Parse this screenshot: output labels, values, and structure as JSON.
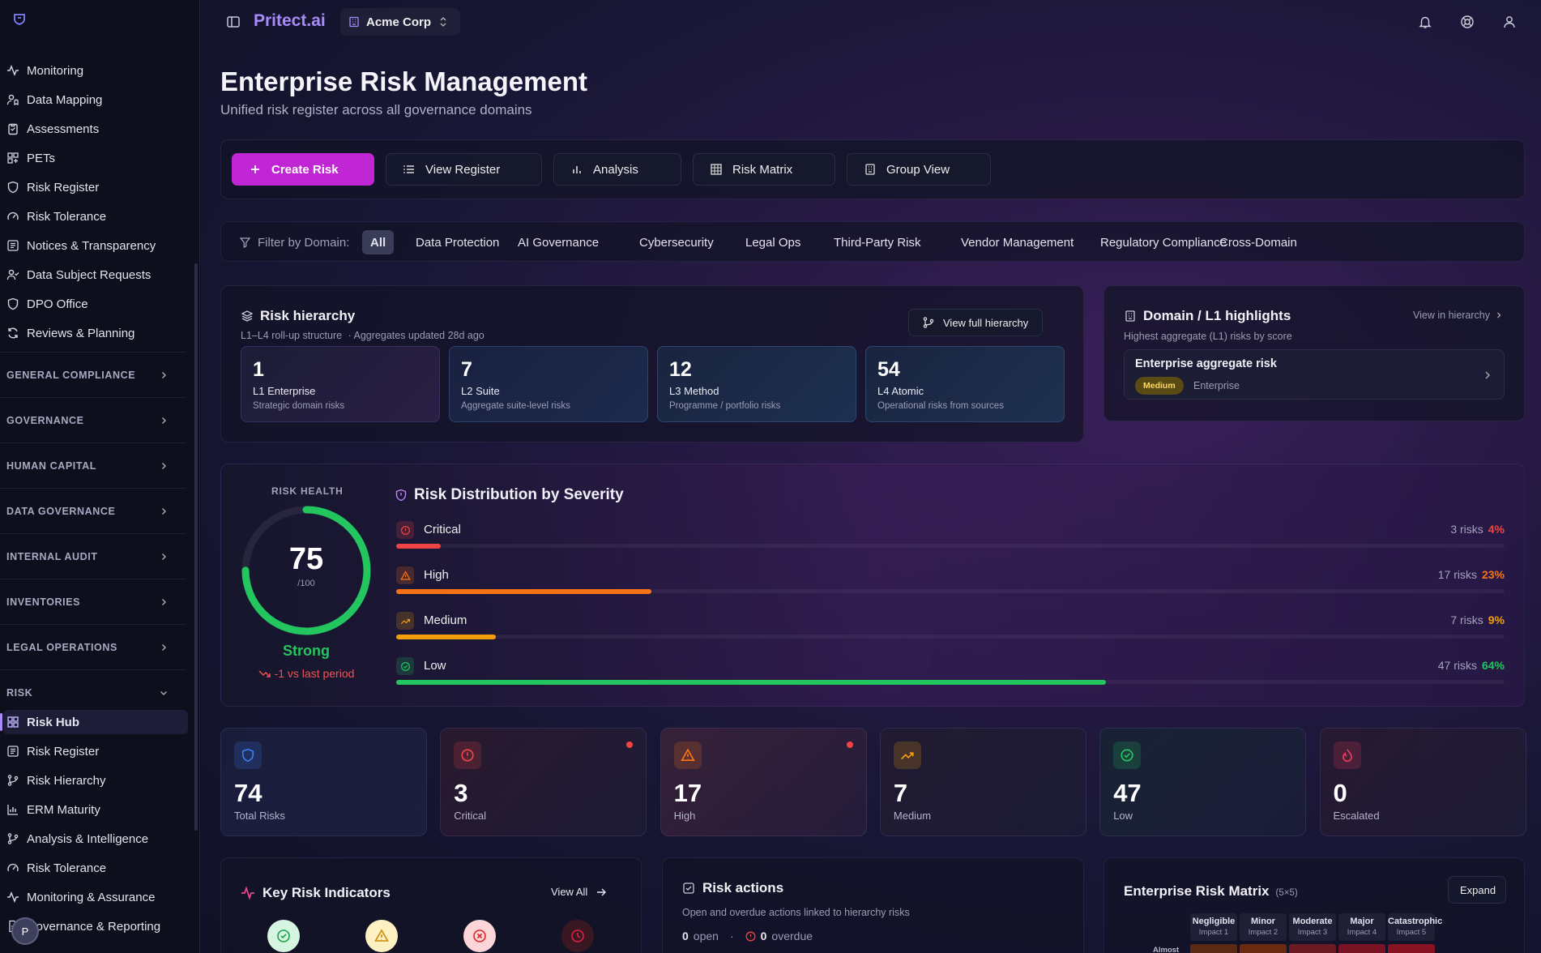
{
  "app": {
    "brand": "Pritect.ai",
    "org": "Acme Corp",
    "avatar_initial": "P"
  },
  "sidebar": {
    "items": [
      {
        "label": "Monitoring",
        "icon": "activity-icon"
      },
      {
        "label": "Data Mapping",
        "icon": "user-map-icon"
      },
      {
        "label": "Assessments",
        "icon": "clipboard-icon"
      },
      {
        "label": "PETs",
        "icon": "grid-icon"
      },
      {
        "label": "Risk Register",
        "icon": "shield-icon"
      },
      {
        "label": "Risk Tolerance",
        "icon": "gauge-icon"
      },
      {
        "label": "Notices & Transparency",
        "icon": "list-icon"
      },
      {
        "label": "Data Subject Requests",
        "icon": "user-check-icon"
      },
      {
        "label": "DPO Office",
        "icon": "shield-icon"
      },
      {
        "label": "Reviews & Planning",
        "icon": "refresh-icon"
      }
    ],
    "groups": [
      "GENERAL COMPLIANCE",
      "GOVERNANCE",
      "HUMAN CAPITAL",
      "DATA GOVERNANCE",
      "INTERNAL AUDIT",
      "INVENTORIES",
      "LEGAL OPERATIONS",
      "RISK"
    ],
    "risk_items": [
      {
        "label": "Risk Hub",
        "icon": "dashboard-icon",
        "active": true
      },
      {
        "label": "Risk Register",
        "icon": "list-icon"
      },
      {
        "label": "Risk Hierarchy",
        "icon": "branch-icon"
      },
      {
        "label": "ERM Maturity",
        "icon": "bar-chart-icon"
      },
      {
        "label": "Analysis & Intelligence",
        "icon": "branch-icon"
      },
      {
        "label": "Risk Tolerance",
        "icon": "gauge-icon"
      },
      {
        "label": "Monitoring & Assurance",
        "icon": "activity-icon"
      },
      {
        "label": "Governance & Reporting",
        "icon": "file-icon"
      }
    ]
  },
  "page": {
    "title": "Enterprise Risk Management",
    "subtitle": "Unified risk register across all governance domains"
  },
  "actions": {
    "create": "Create Risk",
    "view_register": "View Register",
    "analysis": "Analysis",
    "risk_matrix": "Risk Matrix",
    "group_view": "Group View"
  },
  "filter": {
    "label": "Filter by Domain:",
    "chips": [
      "All",
      "Data Protection",
      "AI Governance",
      "Cybersecurity",
      "Legal Ops",
      "Third-Party Risk",
      "Vendor Management",
      "Regulatory Compliance",
      "Cross-Domain"
    ],
    "active": "All"
  },
  "hierarchy": {
    "title": "Risk hierarchy",
    "subtitle": "L1–L4 roll-up structure",
    "updated": "· Aggregates updated 28d ago",
    "button": "View full hierarchy",
    "levels": [
      {
        "count": "1",
        "name": "L1 Enterprise",
        "desc": "Strategic domain risks"
      },
      {
        "count": "7",
        "name": "L2 Suite",
        "desc": "Aggregate suite-level risks"
      },
      {
        "count": "12",
        "name": "L3 Method",
        "desc": "Programme / portfolio risks"
      },
      {
        "count": "54",
        "name": "L4 Atomic",
        "desc": "Operational risks from sources"
      }
    ]
  },
  "highlights": {
    "title": "Domain / L1 highlights",
    "link": "View in hierarchy",
    "subtitle": "Highest aggregate (L1) risks by score",
    "item_title": "Enterprise aggregate risk",
    "item_badge": "Medium",
    "item_scope": "Enterprise"
  },
  "health": {
    "label": "RISK HEALTH",
    "score": "75",
    "score_value": 75,
    "max": "/100",
    "status": "Strong",
    "trend": "-1 vs last period"
  },
  "distribution": {
    "title": "Risk Distribution by Severity",
    "rows": [
      {
        "label": "Critical",
        "count": "3 risks",
        "pct": "4%",
        "value": 4,
        "color": "#ef4444",
        "icon": "alert-circle-icon"
      },
      {
        "label": "High",
        "count": "17 risks",
        "pct": "23%",
        "value": 23,
        "color": "#f97316",
        "icon": "alert-triangle-icon"
      },
      {
        "label": "Medium",
        "count": "7 risks",
        "pct": "9%",
        "value": 9,
        "color": "#f59e0b",
        "icon": "trend-up-icon"
      },
      {
        "label": "Low",
        "count": "47 risks",
        "pct": "64%",
        "value": 64,
        "color": "#22c55e",
        "icon": "check-circle-icon"
      }
    ]
  },
  "stats": [
    {
      "value": "74",
      "label": "Total Risks",
      "color": "#3b82f6",
      "icon": "shield-icon",
      "dot": false
    },
    {
      "value": "3",
      "label": "Critical",
      "color": "#ef4444",
      "icon": "alert-circle-icon",
      "dot": true
    },
    {
      "value": "17",
      "label": "High",
      "color": "#f97316",
      "icon": "alert-triangle-icon",
      "dot": true
    },
    {
      "value": "7",
      "label": "Medium",
      "color": "#f59e0b",
      "icon": "trend-up-icon",
      "dot": false
    },
    {
      "value": "47",
      "label": "Low",
      "color": "#22c55e",
      "icon": "check-circle-icon",
      "dot": false
    },
    {
      "value": "0",
      "label": "Escalated",
      "color": "#f43f5e",
      "icon": "flame-icon",
      "dot": false
    }
  ],
  "kri": {
    "title": "Key Risk Indicators",
    "view_all": "View All"
  },
  "risk_actions": {
    "title": "Risk actions",
    "subtitle": "Open and overdue actions linked to hierarchy risks",
    "open_count": "0",
    "open_label": "open",
    "sep": "·",
    "overdue_count": "0",
    "overdue_label": "overdue"
  },
  "matrix": {
    "title": "Enterprise Risk Matrix",
    "size": "(5×5)",
    "expand": "Expand",
    "columns": [
      {
        "name": "Negligible",
        "impact": "Impact 1"
      },
      {
        "name": "Minor",
        "impact": "Impact 2"
      },
      {
        "name": "Moderate",
        "impact": "Impact 3"
      },
      {
        "name": "Major",
        "impact": "Impact 4"
      },
      {
        "name": "Catastrophic",
        "impact": "Impact 5"
      }
    ],
    "row_label": "Almost",
    "cell_colors": [
      "#5a2a14",
      "#6a2a12",
      "#6b1a22",
      "#7a1424",
      "#871221"
    ]
  }
}
